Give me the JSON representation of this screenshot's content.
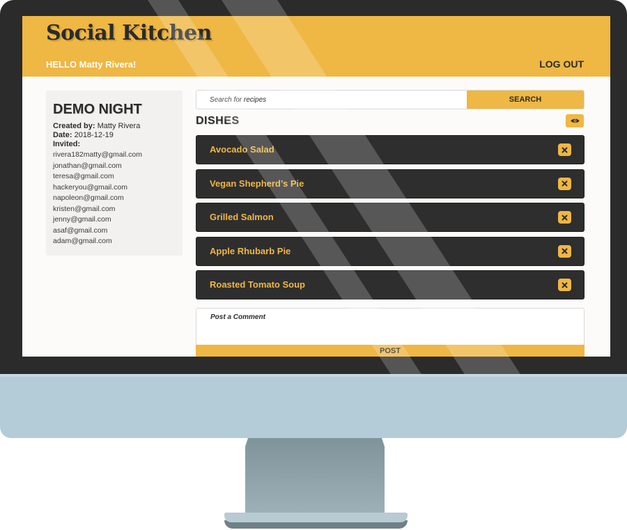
{
  "header": {
    "site_title": "Social Kitchen",
    "greeting": "HELLO Matty Rivera!",
    "logout_label": "LOG OUT"
  },
  "event": {
    "title": "DEMO NIGHT",
    "created_by_label": "Created by:",
    "created_by": "Matty Rivera",
    "date_label": "Date:",
    "date": "2018-12-19",
    "invited_label": "Invited:",
    "invited": [
      "rivera182matty@gmail.com",
      "jonathan@gmail.com",
      "teresa@gmail.com",
      "hackeryou@gmail.com",
      "napoleon@gmail.com",
      "kristen@gmail.com",
      "jenny@gmail.com",
      "asaf@gmail.com",
      "adam@gmail.com"
    ]
  },
  "search": {
    "placeholder": "Search for recipes",
    "button_label": "SEARCH"
  },
  "dishes": {
    "heading": "DISHES",
    "items": [
      "Avocado Salad",
      "Vegan Shepherd’s Pie",
      "Grilled Salmon",
      "Apple Rhubarb Pie",
      "Roasted Tomato Soup"
    ]
  },
  "comment": {
    "placeholder": "Post a Comment",
    "post_label": "POST"
  },
  "icons": {
    "toggle_view": "eye-icon",
    "remove": "close-icon"
  },
  "colors": {
    "accent": "#efb743",
    "dark": "#2e2e2e",
    "bezel": "#2b2b2b",
    "stand": "#b4ccd7"
  }
}
